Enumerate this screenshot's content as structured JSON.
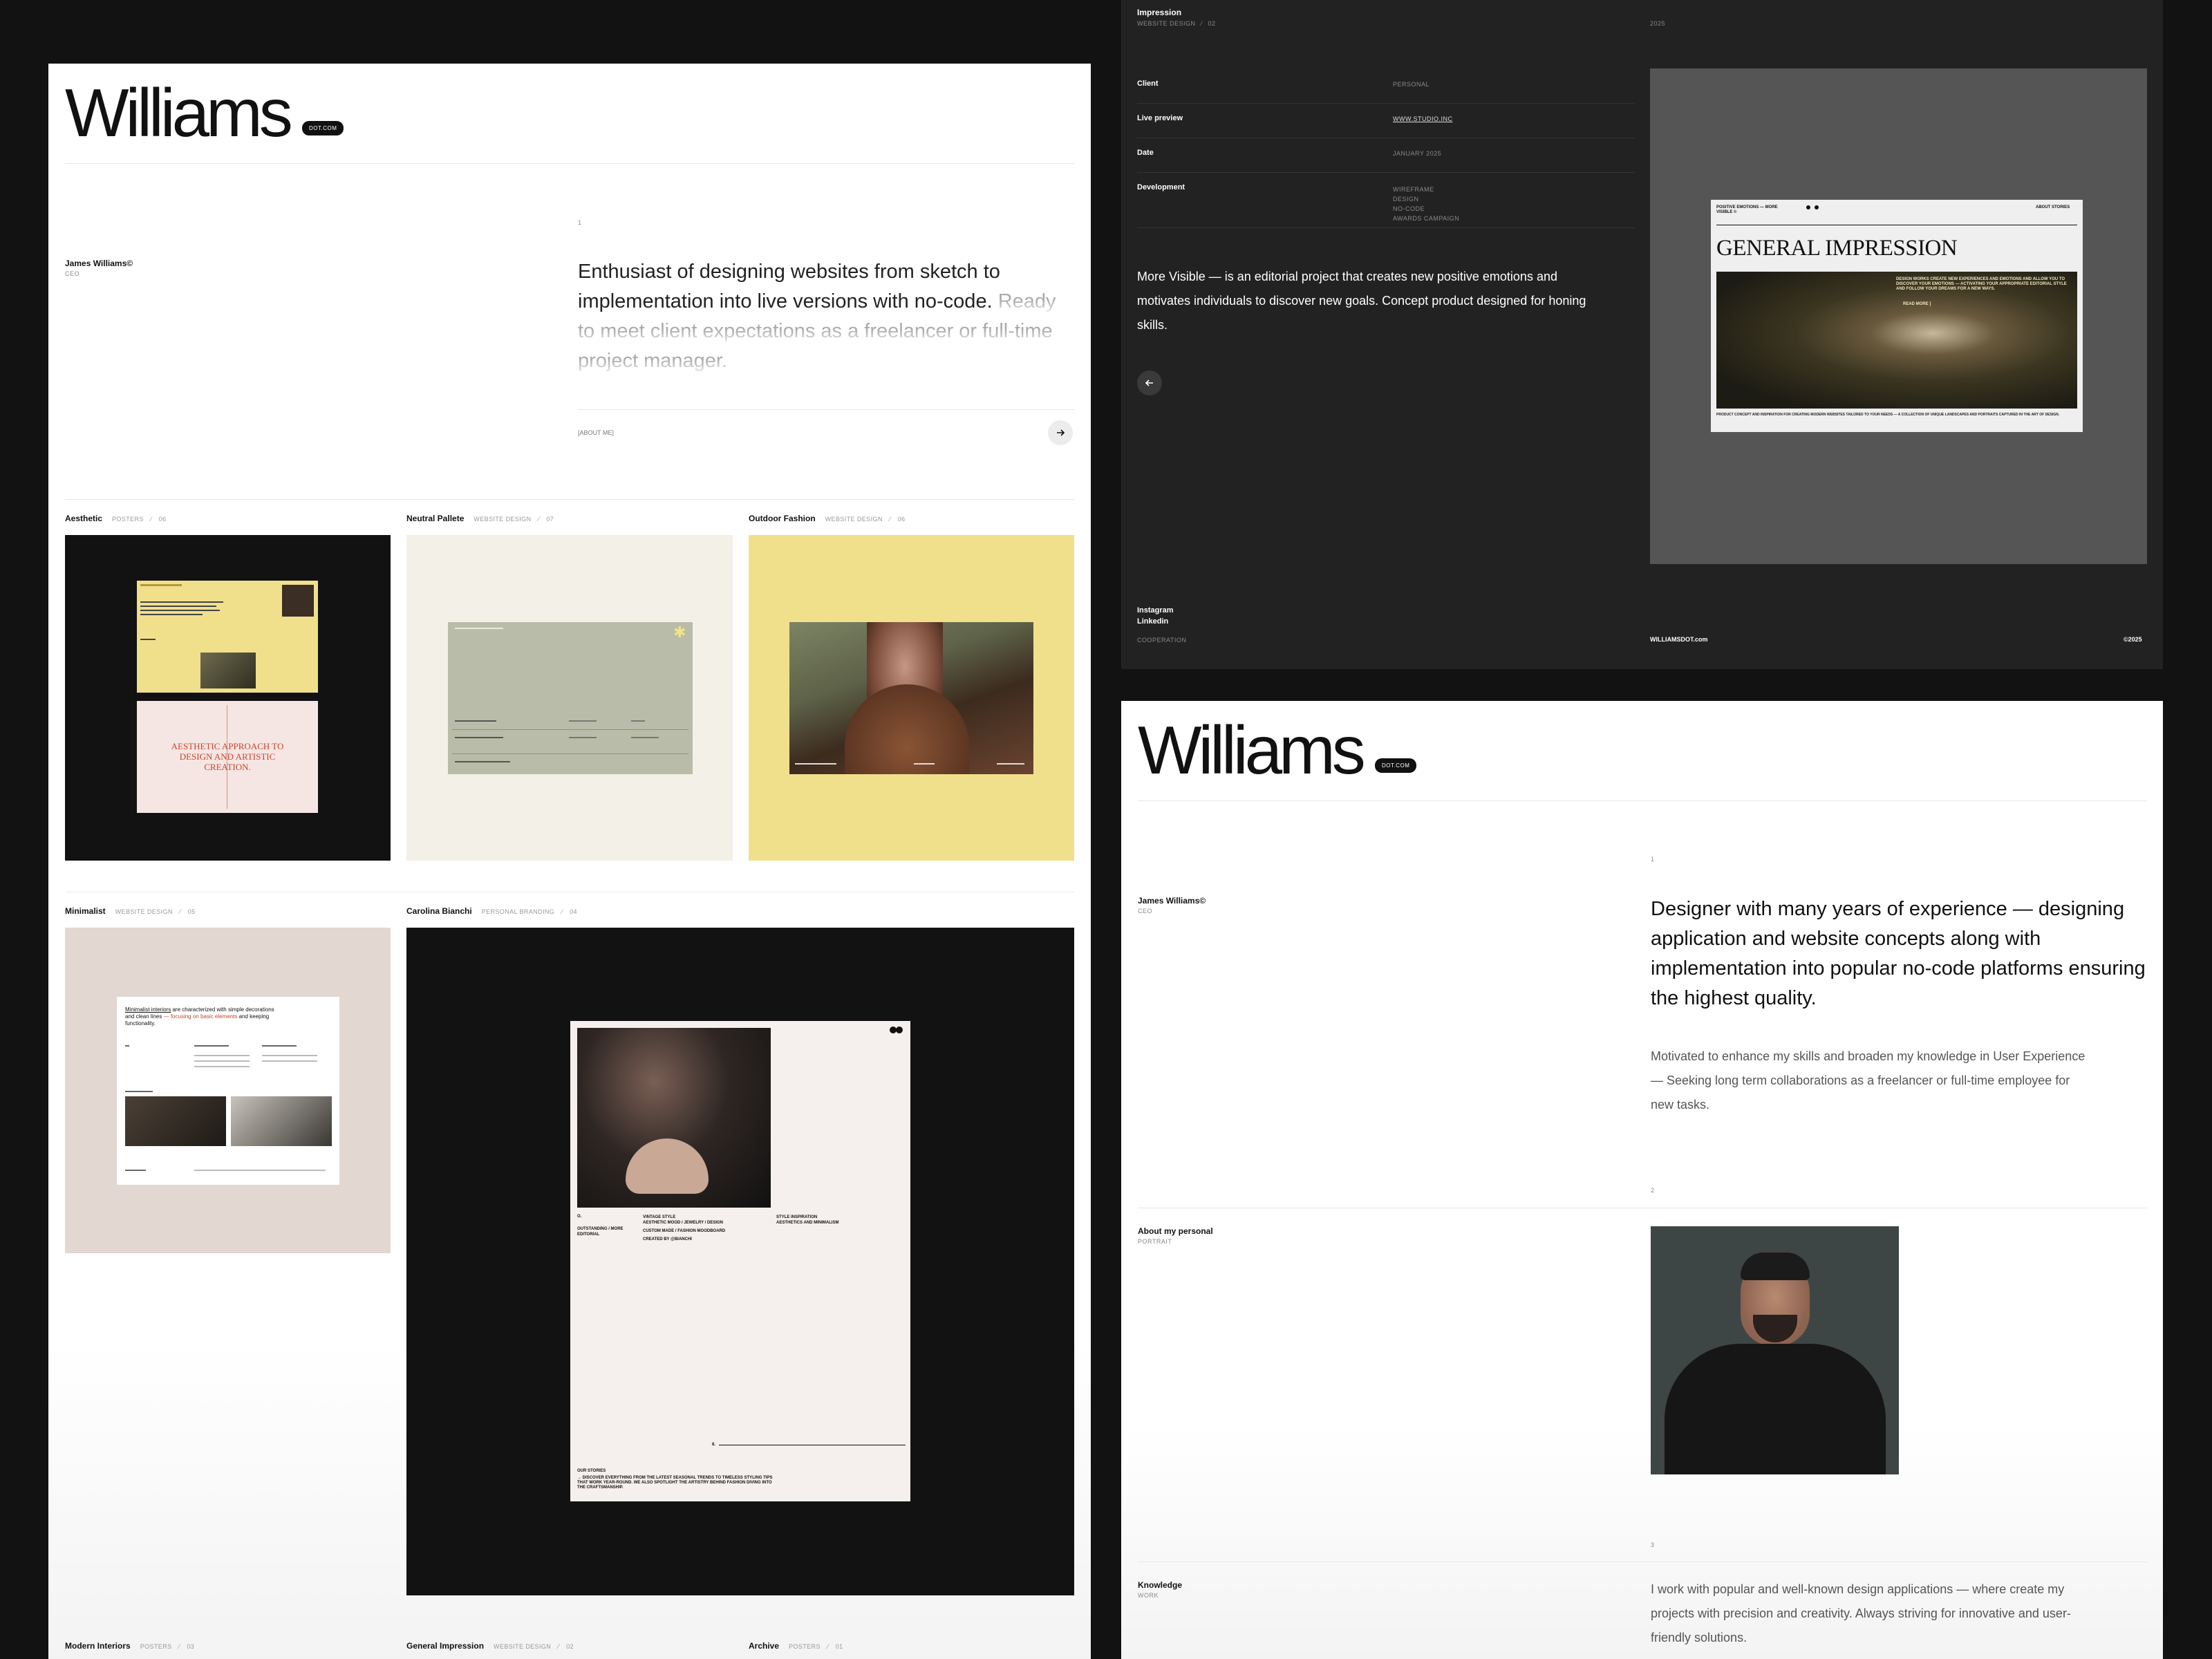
{
  "left": {
    "wordmark": "Williams",
    "pill": "DOT.COM",
    "index1": "1",
    "person": {
      "name": "James Williams©",
      "role": "CEO"
    },
    "intro_dark": "Enthusiast of designing websites from sketch to implementation into live versions with no-code.",
    "intro_light": "Ready to meet client expectations as a freelancer or full-time project manager.",
    "about_link": "[ABOUT ME]",
    "projects": [
      {
        "title": "Aesthetic",
        "tag": "POSTERS",
        "num": "06"
      },
      {
        "title": "Neutral Pallete",
        "tag": "WEBSITE DESIGN",
        "num": "07"
      },
      {
        "title": "Outdoor Fashion",
        "tag": "WEBSITE DESIGN",
        "num": "06"
      },
      {
        "title": "Minimalist",
        "tag": "WEBSITE DESIGN",
        "num": "05"
      },
      {
        "title": "Carolina Bianchi",
        "tag": "PERSONAL BRANDING",
        "num": "04"
      },
      {
        "title": "Modern Interiors",
        "tag": "POSTERS",
        "num": "03"
      },
      {
        "title": "General Impression",
        "tag": "WEBSITE DESIGN",
        "num": "02"
      },
      {
        "title": "Archive",
        "tag": "POSTERS",
        "num": "01"
      }
    ],
    "aesthetic_card_title": "AESTHETIC APPROACH TO DESIGN AND ARTISTIC CREATION.",
    "minimal_card": {
      "h_link": "Minimalist interiors",
      "h_rest": " are characterized with simple decorations and clean lines",
      "h_accent": "— focusing on basic elements",
      "h_end": " and keeping functionality."
    },
    "bianchi_card": {
      "col1": "OUTSTANDING / MORE EDITORIAL",
      "col2a": "VINTAGE STYLE",
      "col2b": "AESTHETIC MOOD / JEWELRY / DESIGN",
      "col2c": "CUSTOM MADE / FASHION MOODBOARD",
      "col2d": "CREATED BY @BIANCHI",
      "col3a": "STYLE INSPIRATION",
      "col3b": "AESTHETICS AND MINIMALISM",
      "stories": "OUR STORIES",
      "stories_text": "→ DISCOVER EVERYTHING FROM THE LATEST SEASONAL TRENDS TO TIMELESS STYLING TIPS THAT WORK YEAR-ROUND. WE ALSO SPOTLIGHT THE ARTISTRY BEHIND FASHION DIVING INTO THE CRAFTSMANSHIP."
    }
  },
  "dark": {
    "title": "Impression",
    "tag": "WEBSITE DESIGN",
    "num": "02",
    "year": "2025",
    "rows": [
      {
        "label": "Client",
        "value": "PERSONAL"
      },
      {
        "label": "Live preview",
        "value": "WWW.STUDIO.INC"
      },
      {
        "label": "Date",
        "value": "JANUARY 2025"
      },
      {
        "label": "Development",
        "value": "WIREFRAME"
      }
    ],
    "dev_extra": [
      "DESIGN",
      "NO-CODE",
      "AWARDS CAMPAIGN"
    ],
    "description": "More Visible — is an editorial project that creates new positive emotions and motivates individuals to discover new goals. Concept product designed for honing skills.",
    "mock": {
      "top_left": "POSITIVE EMOTIONS — MORE VISIBLE ©",
      "top_right": "ABOUT STORIES",
      "headline": "GENERAL IMPRESSION",
      "overlay": "DESIGN WORKS CREATE NEW EXPERIENCES AND EMOTIONS AND ALLOW YOU TO DISCOVER YOUR EMOTIONS — ACTIVATING YOUR APPROPRIATE EDITORIAL STYLE AND FOLLOW YOUR DREAMS FOR A NEW WAYS.",
      "read_more": "READ MORE ]",
      "footer": "PRODUCT CONCEPT AND INSPIRATION FOR CREATING MODERN WEBSITES TAILORED TO YOUR NEEDS — A COLLECTION OF UNIQUE LANDSCAPES AND PORTRAITS CAPTURED IN THE ART OF DESIGN."
    },
    "footer": {
      "instagram": "Instagram",
      "linkedin": "Linkedin",
      "coop": "COOPERATION",
      "site": "WILLIAMSDOT.com",
      "copy": "©2025"
    }
  },
  "right": {
    "wordmark": "Williams",
    "pill": "DOT.COM",
    "idx1": "1",
    "person": {
      "name": "James Williams©",
      "role": "CEO"
    },
    "headline": "Designer with many years of experience — designing application and website concepts along with implementation into popular no-code platforms ensuring the highest quality.",
    "para": "Motivated to enhance my skills and broaden my knowledge in User Experience — Seeking long term collaborations as a freelancer or full-time employee for new tasks.",
    "idx2": "2",
    "about": {
      "title": "About my personal",
      "sub": "PORTRAIT"
    },
    "idx3": "3",
    "knowledge": {
      "title": "Knowledge",
      "sub": "WORK"
    },
    "knowledge_text": "I work with popular and well-known design applications — where create my projects with precision and creativity. Always striving for innovative and user-friendly solutions."
  },
  "colors": {
    "bg": "#121212",
    "dark_panel": "#222222",
    "yellow": "#f0e08c",
    "cream": "#f3f0e7",
    "taupe": "#e2d7d1",
    "accent_red": "#c8452a"
  }
}
